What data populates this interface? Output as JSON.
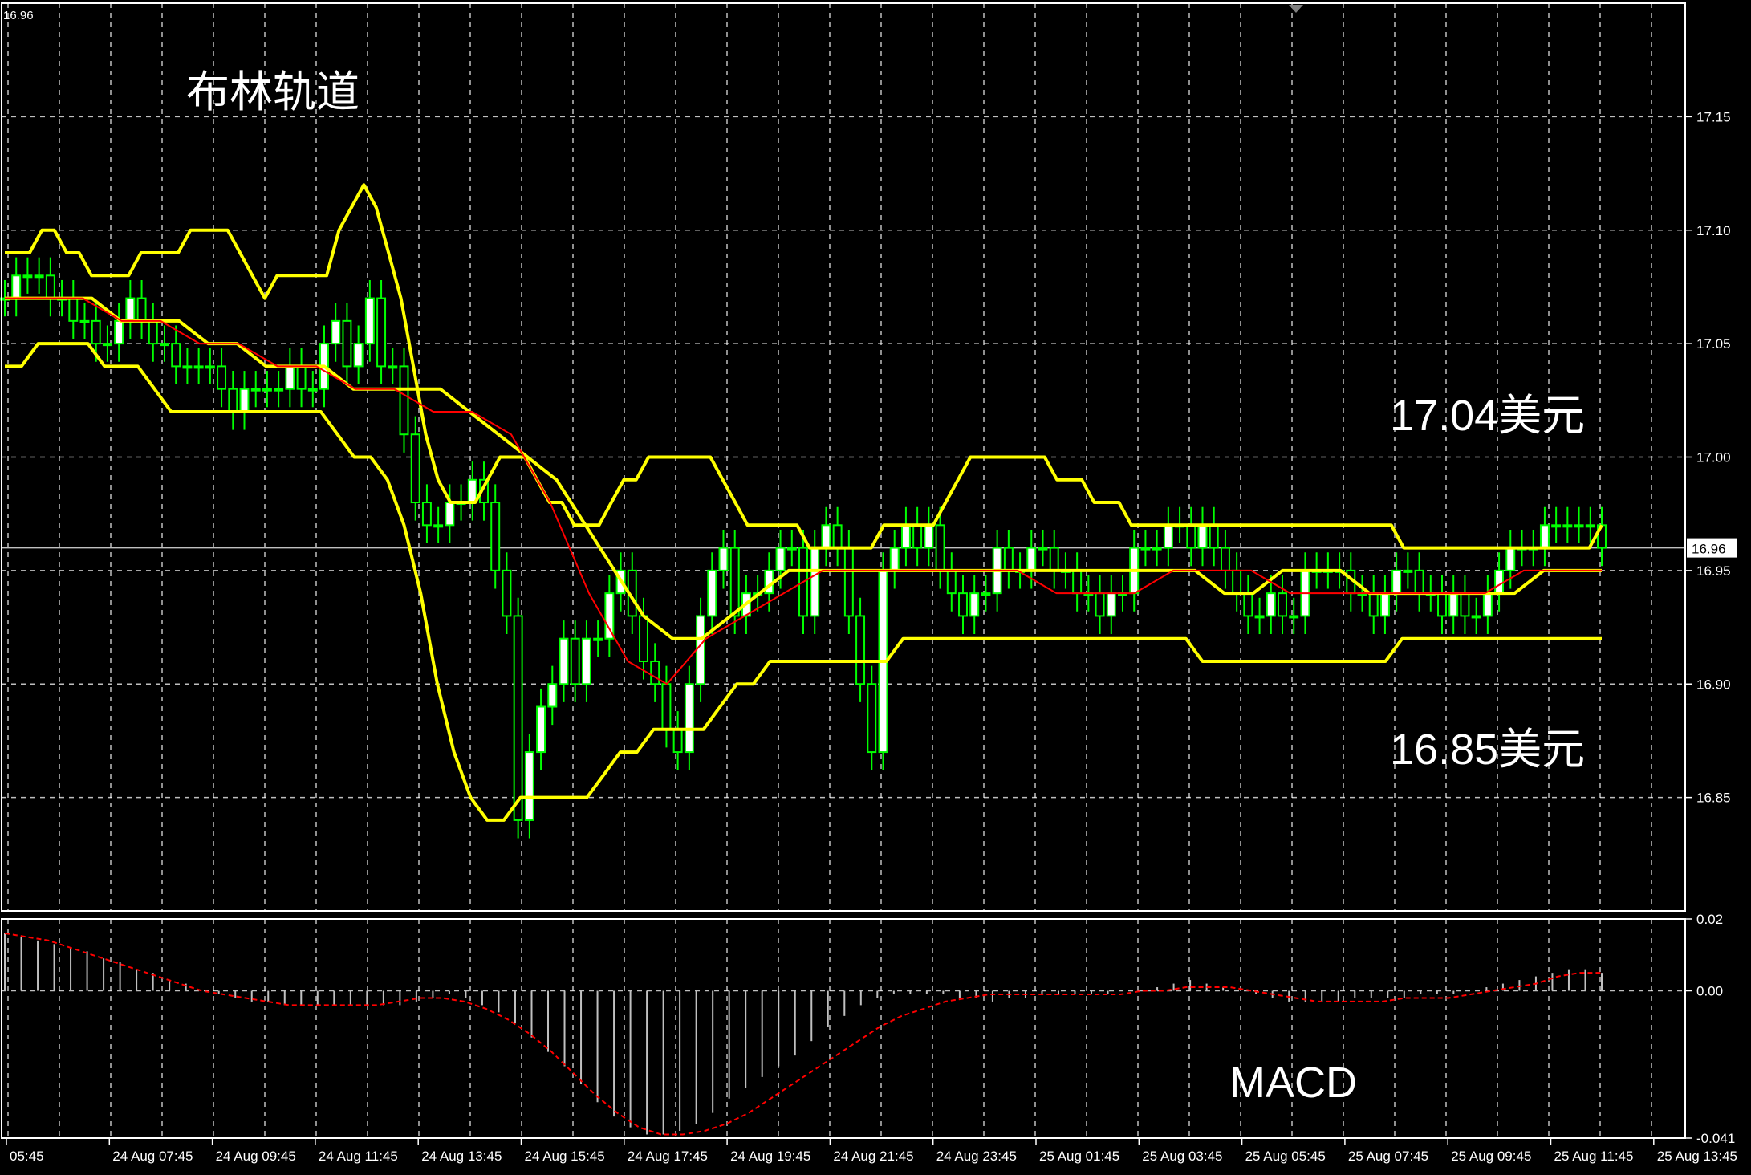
{
  "header": {
    "corner_value": "16.96"
  },
  "annotations": {
    "title": "布林轨道",
    "upper_label": "17.04美元",
    "lower_label": "16.85美元",
    "macd_label": "MACD"
  },
  "colors": {
    "background": "#000000",
    "grid": "#ffffff",
    "bullish_candle": "#00ff00",
    "bullish_body": "#ffffff",
    "bearish_candle": "#00ff00",
    "bollinger": "#ffff00",
    "moving_average": "#ff0000",
    "macd_hist": "#c0c0c0",
    "macd_signal": "#ff0000",
    "price_marker_bg": "#ffffff",
    "price_marker_text": "#000000"
  },
  "chart_data": [
    {
      "type": "candlestick",
      "panel": "price",
      "indicator": "Bollinger Bands",
      "ylim": [
        16.8,
        17.2
      ],
      "yticks": [
        "17.15",
        "17.10",
        "17.05",
        "17.00",
        "16.95",
        "16.90",
        "16.85"
      ],
      "current_price": "16.96",
      "grid": true,
      "x_labels": [
        "05:45",
        "24 Aug 07:45",
        "24 Aug 09:45",
        "24 Aug 11:45",
        "24 Aug 13:45",
        "24 Aug 15:45",
        "24 Aug 17:45",
        "24 Aug 19:45",
        "24 Aug 21:45",
        "24 Aug 23:45",
        "25 Aug 01:45",
        "25 Aug 03:45",
        "25 Aug 05:45",
        "25 Aug 07:45",
        "25 Aug 09:45",
        "25 Aug 11:45",
        "25 Aug 13:45"
      ],
      "close": [
        17.07,
        17.08,
        17.08,
        17.08,
        17.07,
        17.07,
        17.06,
        17.06,
        17.05,
        17.05,
        17.06,
        17.07,
        17.06,
        17.05,
        17.05,
        17.04,
        17.04,
        17.04,
        17.04,
        17.03,
        17.02,
        17.03,
        17.03,
        17.03,
        17.03,
        17.04,
        17.03,
        17.03,
        17.05,
        17.06,
        17.04,
        17.05,
        17.07,
        17.04,
        17.04,
        17.01,
        16.98,
        16.97,
        16.97,
        16.98,
        16.98,
        16.99,
        16.98,
        16.95,
        16.93,
        16.84,
        16.87,
        16.89,
        16.9,
        16.92,
        16.9,
        16.92,
        16.92,
        16.94,
        16.95,
        16.93,
        16.91,
        16.9,
        16.88,
        16.87,
        16.9,
        16.93,
        16.95,
        16.96,
        16.93,
        16.94,
        16.94,
        16.95,
        16.96,
        16.96,
        16.93,
        16.96,
        16.97,
        16.96,
        16.93,
        16.9,
        16.87,
        16.95,
        16.96,
        16.97,
        16.96,
        16.97,
        16.95,
        16.94,
        16.93,
        16.94,
        16.94,
        16.96,
        16.95,
        16.95,
        16.96,
        16.96,
        16.95,
        16.95,
        16.94,
        16.94,
        16.93,
        16.94,
        16.94,
        16.96,
        16.96,
        16.96,
        16.97,
        16.97,
        16.96,
        16.97,
        16.96,
        16.95,
        16.94,
        16.93,
        16.93,
        16.94,
        16.93,
        16.93,
        16.95,
        16.95,
        16.95,
        16.95,
        16.94,
        16.94,
        16.93,
        16.94,
        16.95,
        16.95,
        16.94,
        16.94,
        16.93,
        16.94,
        16.93,
        16.93,
        16.94,
        16.95,
        16.96,
        16.96,
        16.96,
        16.97,
        16.97,
        16.97,
        16.97,
        16.97,
        16.96
      ],
      "upper_band": [
        17.09,
        17.09,
        17.09,
        17.1,
        17.1,
        17.09,
        17.09,
        17.08,
        17.08,
        17.08,
        17.08,
        17.09,
        17.09,
        17.09,
        17.09,
        17.1,
        17.1,
        17.1,
        17.1,
        17.09,
        17.08,
        17.07,
        17.08,
        17.08,
        17.08,
        17.08,
        17.08,
        17.1,
        17.11,
        17.12,
        17.11,
        17.09,
        17.07,
        17.04,
        17.01,
        16.99,
        16.98,
        16.98,
        16.98,
        16.99,
        17.0,
        17.0,
        17.0,
        16.99,
        16.98,
        16.98,
        16.97,
        16.97,
        16.97,
        16.98,
        16.99,
        16.99,
        17.0,
        17.0,
        17.0,
        17.0,
        17.0,
        17.0,
        16.99,
        16.98,
        16.97,
        16.97,
        16.97,
        16.97,
        16.97,
        16.96,
        16.96,
        16.96,
        16.96,
        16.96,
        16.96,
        16.97,
        16.97,
        16.97,
        16.97,
        16.97,
        16.98,
        16.99,
        17.0,
        17.0,
        17.0,
        17.0,
        17.0,
        17.0,
        17.0,
        16.99,
        16.99,
        16.99,
        16.98,
        16.98,
        16.98,
        16.97,
        16.97,
        16.97,
        16.97,
        16.97,
        16.97,
        16.97,
        16.97,
        16.97,
        16.97,
        16.97,
        16.97,
        16.97,
        16.97,
        16.97,
        16.97,
        16.97,
        16.97,
        16.97,
        16.97,
        16.97,
        16.97,
        16.96,
        16.96,
        16.96,
        16.96,
        16.96,
        16.96,
        16.96,
        16.96,
        16.96,
        16.96,
        16.96,
        16.96,
        16.96,
        16.96,
        16.96,
        16.96,
        16.97
      ],
      "lower_band": [
        17.04,
        17.04,
        17.05,
        17.05,
        17.05,
        17.05,
        17.04,
        17.04,
        17.04,
        17.03,
        17.02,
        17.02,
        17.02,
        17.02,
        17.02,
        17.02,
        17.02,
        17.02,
        17.02,
        17.02,
        17.01,
        17.0,
        17.0,
        16.99,
        16.97,
        16.94,
        16.9,
        16.87,
        16.85,
        16.84,
        16.84,
        16.85,
        16.85,
        16.85,
        16.85,
        16.85,
        16.86,
        16.87,
        16.87,
        16.88,
        16.88,
        16.88,
        16.88,
        16.89,
        16.9,
        16.9,
        16.91,
        16.91,
        16.91,
        16.91,
        16.91,
        16.91,
        16.91,
        16.91,
        16.92,
        16.92,
        16.92,
        16.92,
        16.92,
        16.92,
        16.92,
        16.92,
        16.92,
        16.92,
        16.92,
        16.92,
        16.92,
        16.92,
        16.92,
        16.92,
        16.92,
        16.92,
        16.91,
        16.91,
        16.91,
        16.91,
        16.91,
        16.91,
        16.91,
        16.91,
        16.91,
        16.91,
        16.91,
        16.91,
        16.92,
        16.92,
        16.92,
        16.92,
        16.92,
        16.92,
        16.92,
        16.92,
        16.92,
        16.92,
        16.92,
        16.92,
        16.92
      ],
      "middle_band": [
        17.07,
        17.07,
        17.07,
        17.07,
        17.06,
        17.06,
        17.06,
        17.05,
        17.05,
        17.04,
        17.04,
        17.04,
        17.03,
        17.03,
        17.03,
        17.03,
        17.02,
        17.01,
        17.0,
        16.99,
        16.97,
        16.95,
        16.93,
        16.92,
        16.92,
        16.93,
        16.94,
        16.95,
        16.95,
        16.95,
        16.95,
        16.95,
        16.95,
        16.95,
        16.95,
        16.95,
        16.95,
        16.95,
        16.95,
        16.95,
        16.95,
        16.95,
        16.94,
        16.94,
        16.95,
        16.95,
        16.95,
        16.94,
        16.94,
        16.94,
        16.94,
        16.94,
        16.94,
        16.95,
        16.95,
        16.95
      ],
      "moving_average": [
        17.07,
        17.07,
        17.07,
        17.06,
        17.06,
        17.05,
        17.05,
        17.04,
        17.04,
        17.03,
        17.03,
        17.02,
        17.02,
        17.01,
        16.98,
        16.94,
        16.91,
        16.9,
        16.92,
        16.93,
        16.94,
        16.95,
        16.95,
        16.95,
        16.95,
        16.95,
        16.95,
        16.94,
        16.94,
        16.94,
        16.95,
        16.95,
        16.95,
        16.94,
        16.94,
        16.94,
        16.94,
        16.94,
        16.94,
        16.95,
        16.95,
        16.95
      ]
    },
    {
      "type": "macd",
      "panel": "indicator",
      "ylim": [
        -0.041,
        0.02
      ],
      "yticks": [
        "0.02",
        "0.00",
        "-0.041"
      ],
      "histogram": [
        0.016,
        0.015,
        0.014,
        0.013,
        0.012,
        0.011,
        0.009,
        0.008,
        0.006,
        0.005,
        0.003,
        0.002,
        0.0,
        -0.001,
        -0.002,
        -0.003,
        -0.003,
        -0.004,
        -0.004,
        -0.004,
        -0.004,
        -0.004,
        -0.004,
        -0.004,
        -0.004,
        -0.003,
        -0.002,
        -0.001,
        -0.002,
        -0.004,
        -0.006,
        -0.009,
        -0.013,
        -0.017,
        -0.021,
        -0.026,
        -0.031,
        -0.035,
        -0.038,
        -0.04,
        -0.04,
        -0.039,
        -0.037,
        -0.034,
        -0.03,
        -0.027,
        -0.024,
        -0.021,
        -0.018,
        -0.014,
        -0.01,
        -0.007,
        -0.004,
        -0.002,
        -0.001,
        -0.001,
        -0.001,
        -0.001,
        -0.002,
        -0.002,
        -0.003,
        -0.002,
        -0.002,
        -0.001,
        -0.001,
        -0.001,
        -0.001,
        -0.001,
        0.0,
        0.0,
        0.001,
        0.002,
        0.003,
        0.002,
        0.001,
        0.0,
        -0.001,
        -0.002,
        -0.003,
        -0.003,
        -0.003,
        -0.003,
        -0.002,
        -0.002,
        -0.002,
        -0.002,
        -0.001,
        -0.001,
        -0.001,
        0.0,
        0.001,
        0.002,
        0.003,
        0.004,
        0.005,
        0.006,
        0.006,
        0.005
      ],
      "signal": [
        0.016,
        0.015,
        0.014,
        0.012,
        0.01,
        0.008,
        0.006,
        0.004,
        0.002,
        0.0,
        -0.001,
        -0.002,
        -0.003,
        -0.004,
        -0.004,
        -0.004,
        -0.004,
        -0.004,
        -0.003,
        -0.002,
        -0.002,
        -0.003,
        -0.005,
        -0.008,
        -0.012,
        -0.017,
        -0.023,
        -0.029,
        -0.034,
        -0.038,
        -0.04,
        -0.04,
        -0.039,
        -0.037,
        -0.034,
        -0.03,
        -0.026,
        -0.022,
        -0.018,
        -0.014,
        -0.01,
        -0.007,
        -0.005,
        -0.003,
        -0.002,
        -0.001,
        -0.001,
        -0.001,
        -0.001,
        -0.001,
        -0.001,
        -0.001,
        0.0,
        0.0,
        0.001,
        0.001,
        0.001,
        0.0,
        -0.001,
        -0.002,
        -0.003,
        -0.003,
        -0.003,
        -0.003,
        -0.002,
        -0.002,
        -0.002,
        -0.001,
        0.0,
        0.001,
        0.002,
        0.004,
        0.005,
        0.005
      ]
    }
  ]
}
